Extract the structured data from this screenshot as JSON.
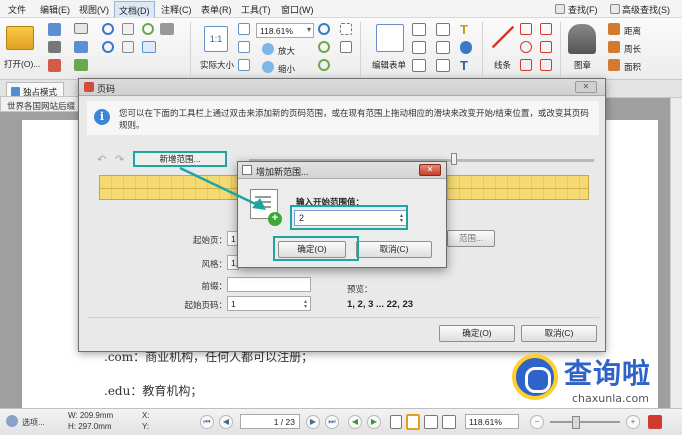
{
  "menubar": {
    "items": [
      "文件",
      "编辑(E)",
      "视图(V)",
      "文档(D)",
      "注释(C)",
      "表单(R)",
      "工具(T)",
      "窗口(W)"
    ],
    "active_index": 3,
    "search_label": "查找(F)",
    "adv_search_label": "高级查找(S)"
  },
  "ribbon": {
    "open_label": "打开(O)...",
    "zoom_value": "118.61%",
    "actual_size_label": "实际大小",
    "zoom_in_label": "放大",
    "zoom_out_label": "缩小",
    "edit_form_label": "编辑表单",
    "lines_label": "线条",
    "stamp_label": "图章",
    "distance_label": "距离",
    "perimeter_label": "周长",
    "area_label": "面积"
  },
  "tabs": {
    "tab1": "独占模式",
    "tab2": "世界各国网站后缀"
  },
  "document": {
    "line1": ".com：商业机构，任何人都可以注册；",
    "line2": ".edu：教育机构；"
  },
  "dialog": {
    "title": "页码",
    "info": "您可以在下面的工具栏上通过双击来添加新的页码范围，或在现有范围上拖动相应的滑块来改变开始/结束位置，或改变其页码规则。",
    "new_range_label": "新增范围...",
    "start_page_label": "起始页：",
    "start_page_value": "1",
    "style_label": "风格：",
    "style_value": "1,",
    "prefix_label": "前缀：",
    "prefix_value": "",
    "start_number_label": "起始页码：",
    "start_number_value": "1",
    "range_button_label": "范围...",
    "preview_label": "预览：",
    "preview_value": "1, 2, 3 ... 22, 23",
    "ok_label": "确定(O)",
    "cancel_label": "取消(C)"
  },
  "subdialog": {
    "title": "增加新范围...",
    "input_label": "输入开始范围值：",
    "input_value": "2",
    "ok_label": "确定(O)",
    "cancel_label": "取消(C)"
  },
  "statusbar": {
    "options_label": "选项...",
    "width_label": "W: 209.9mm",
    "height_label": "H: 297.0mm",
    "x_label": "X:",
    "y_label": "Y:",
    "page_value": "1 / 23",
    "zoom_value": "118.61%"
  },
  "watermark": {
    "brand": "查询啦",
    "domain": "chaxunla.com"
  },
  "colors": {
    "highlight": "#1aa7a1",
    "ruler": "#f5da74",
    "info_icon": "#3a86d8"
  }
}
